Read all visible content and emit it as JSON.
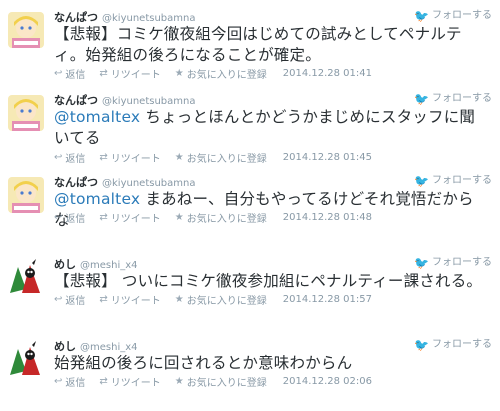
{
  "labels": {
    "follow": "フォローする",
    "reply": "返信",
    "retweet": "リツイート",
    "favorite": "お気に入りに登録"
  },
  "icons": {
    "bird": "twitter-bird-icon",
    "reply": "reply-icon",
    "retweet": "retweet-icon",
    "favorite": "star-icon"
  },
  "colors": {
    "mention": "#2b7bb9",
    "meta": "#8899a6",
    "text": "#292f33"
  },
  "tweets": [
    {
      "name": "なんぱつ",
      "handle": "@kiyunetsubamna",
      "text": "【悲報】コミケ徹夜組今回はじめての試みとしてペナルティ。始発組の後ろになることが確定。",
      "time": "2014.12.28 01:41"
    },
    {
      "name": "なんぱつ",
      "handle": "@kiyunetsubamna",
      "mention": "@tomaltex",
      "text": " ちょっとほんとかどうかまじめにスタッフに聞いてる",
      "time": "2014.12.28 01:45"
    },
    {
      "name": "なんぱつ",
      "handle": "@kiyunetsubamna",
      "mention": "@tomaltex",
      "text": " まあねー、自分もやってるけどそれ覚悟だからな",
      "time": "2014.12.28 01:48"
    },
    {
      "name": "めし",
      "handle": "@meshi_x4",
      "text": "【悲報】 ついにコミケ徹夜参加組にペナルティー課される。",
      "time": "2014.12.28 01:57"
    },
    {
      "name": "めし",
      "handle": "@meshi_x4",
      "text": "始発組の後ろに回されるとか意味わからん",
      "time": "2014.12.28 02:06"
    }
  ]
}
